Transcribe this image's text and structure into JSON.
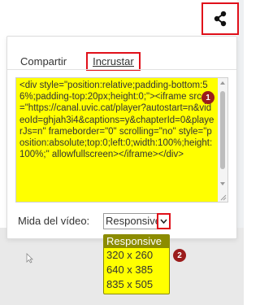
{
  "share": {
    "icon": "share-icon"
  },
  "tabs": [
    {
      "label": "Compartir",
      "active": false
    },
    {
      "label": "Incrustar",
      "active": true
    }
  ],
  "embed": {
    "code": "<div style=\"position:relative;padding-bottom:56%;padding-top:20px;height:0;\"><iframe src=\"https://canal.uvic.cat/player?autostart=n&videoId=ghjah3i4&captions=y&chapterId=0&playerJs=n\" frameborder=\"0\" scrolling=\"no\" style=\"position:absolute;top:0;left:0;width:100%;height:100%;\" allowfullscreen></iframe></div>"
  },
  "size": {
    "label": "Mida del vídeo:",
    "selected": "Responsive",
    "options": [
      "Responsive",
      "320 x 260",
      "640 x 385",
      "835 x 505"
    ]
  },
  "annotations": {
    "badge1": "1",
    "badge2": "2"
  },
  "colors": {
    "highlight": "#ffff00",
    "annotation_red": "#e0101a",
    "badge": "#9b1c1c"
  }
}
